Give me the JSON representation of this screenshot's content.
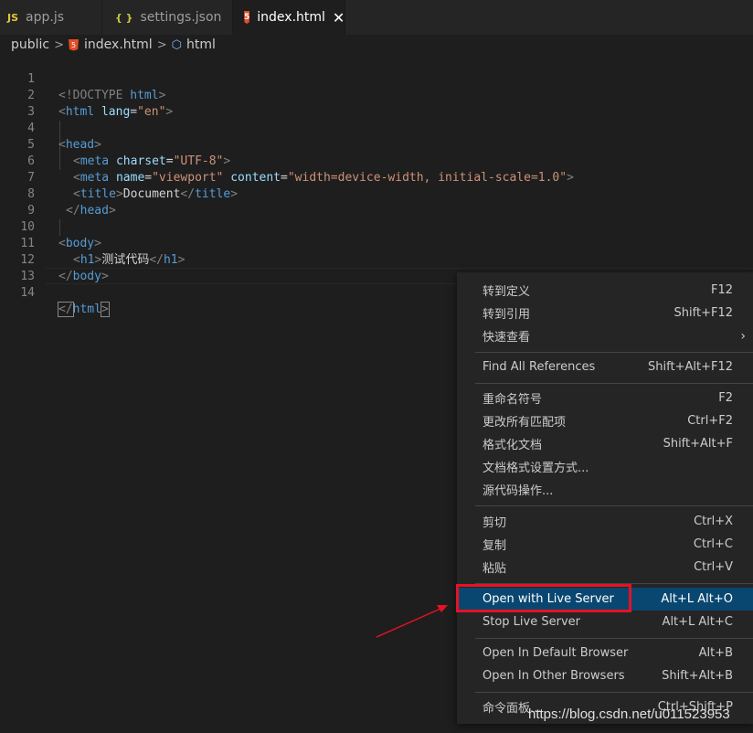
{
  "tabs": [
    {
      "icon": "JS",
      "label": "app.js"
    },
    {
      "icon": "{ }",
      "label": "settings.json"
    },
    {
      "icon": "5",
      "label": "index.html",
      "close": "✕"
    }
  ],
  "breadcrumb": {
    "folder": "public",
    "file_icon": "5",
    "file": "index.html",
    "symbol": "html"
  },
  "code": {
    "line_numbers": [
      "1",
      "2",
      "3",
      "4",
      "5",
      "6",
      "7",
      "8",
      "9",
      "10",
      "11",
      "12",
      "13",
      "14"
    ],
    "l1": {
      "a": "<!DOCTYPE ",
      "b": "html",
      "c": ">"
    },
    "l2": {
      "open": "<",
      "tag": "html",
      "attr": " lang",
      "eq": "=",
      "val": "\"en\"",
      "close": ">"
    },
    "l4": {
      "open": "<",
      "tag": "head",
      "close": ">"
    },
    "l5": {
      "open": "<",
      "tag": "meta",
      "attr": " charset",
      "eq": "=",
      "val": "\"UTF-8\"",
      "close": ">"
    },
    "l6": {
      "open": "<",
      "tag": "meta",
      "attr1": " name",
      "eq1": "=",
      "val1": "\"viewport\"",
      "attr2": " content",
      "eq2": "=",
      "val2": "\"width=device-width, initial-scale=1.0\"",
      "close": ">"
    },
    "l7": {
      "open": "<",
      "tag": "title",
      "close": ">",
      "text": "Document",
      "open2": "</",
      "tag2": "title",
      "close2": ">"
    },
    "l8": {
      "open": "</",
      "tag": "head",
      "close": ">"
    },
    "l10": {
      "open": "<",
      "tag": "body",
      "close": ">"
    },
    "l11": {
      "open": "<",
      "tag": "h1",
      "close": ">",
      "text": "测试代码",
      "open2": "</",
      "tag2": "h1",
      "close2": ">"
    },
    "l12": {
      "open": "</",
      "tag": "body",
      "close": ">"
    },
    "l14": {
      "open": "</",
      "tag": "html",
      "close": ">"
    }
  },
  "context_menu": {
    "items": [
      {
        "label": "转到定义",
        "key": "F12"
      },
      {
        "label": "转到引用",
        "key": "Shift+F12"
      },
      {
        "label": "快速查看",
        "key": "",
        "submenu": "›"
      },
      {
        "label": "Find All References",
        "key": "Shift+Alt+F12"
      },
      {
        "label": "重命名符号",
        "key": "F2"
      },
      {
        "label": "更改所有匹配项",
        "key": "Ctrl+F2"
      },
      {
        "label": "格式化文档",
        "key": "Shift+Alt+F"
      },
      {
        "label": "文档格式设置方式...",
        "key": ""
      },
      {
        "label": "源代码操作...",
        "key": ""
      },
      {
        "label": "剪切",
        "key": "Ctrl+X"
      },
      {
        "label": "复制",
        "key": "Ctrl+C"
      },
      {
        "label": "粘贴",
        "key": "Ctrl+V"
      },
      {
        "label": "Open with Live Server",
        "key": "Alt+L Alt+O"
      },
      {
        "label": "Stop Live Server",
        "key": "Alt+L Alt+C"
      },
      {
        "label": "Open In Default Browser",
        "key": "Alt+B"
      },
      {
        "label": "Open In Other Browsers",
        "key": "Shift+Alt+B"
      },
      {
        "label": "命令面板...",
        "key": "Ctrl+Shift+P"
      }
    ],
    "selected_index": 12
  },
  "watermark": "https://blog.csdn.net/u011523953",
  "colors": {
    "accent": "#094771",
    "highlight_box": "#e81123"
  }
}
